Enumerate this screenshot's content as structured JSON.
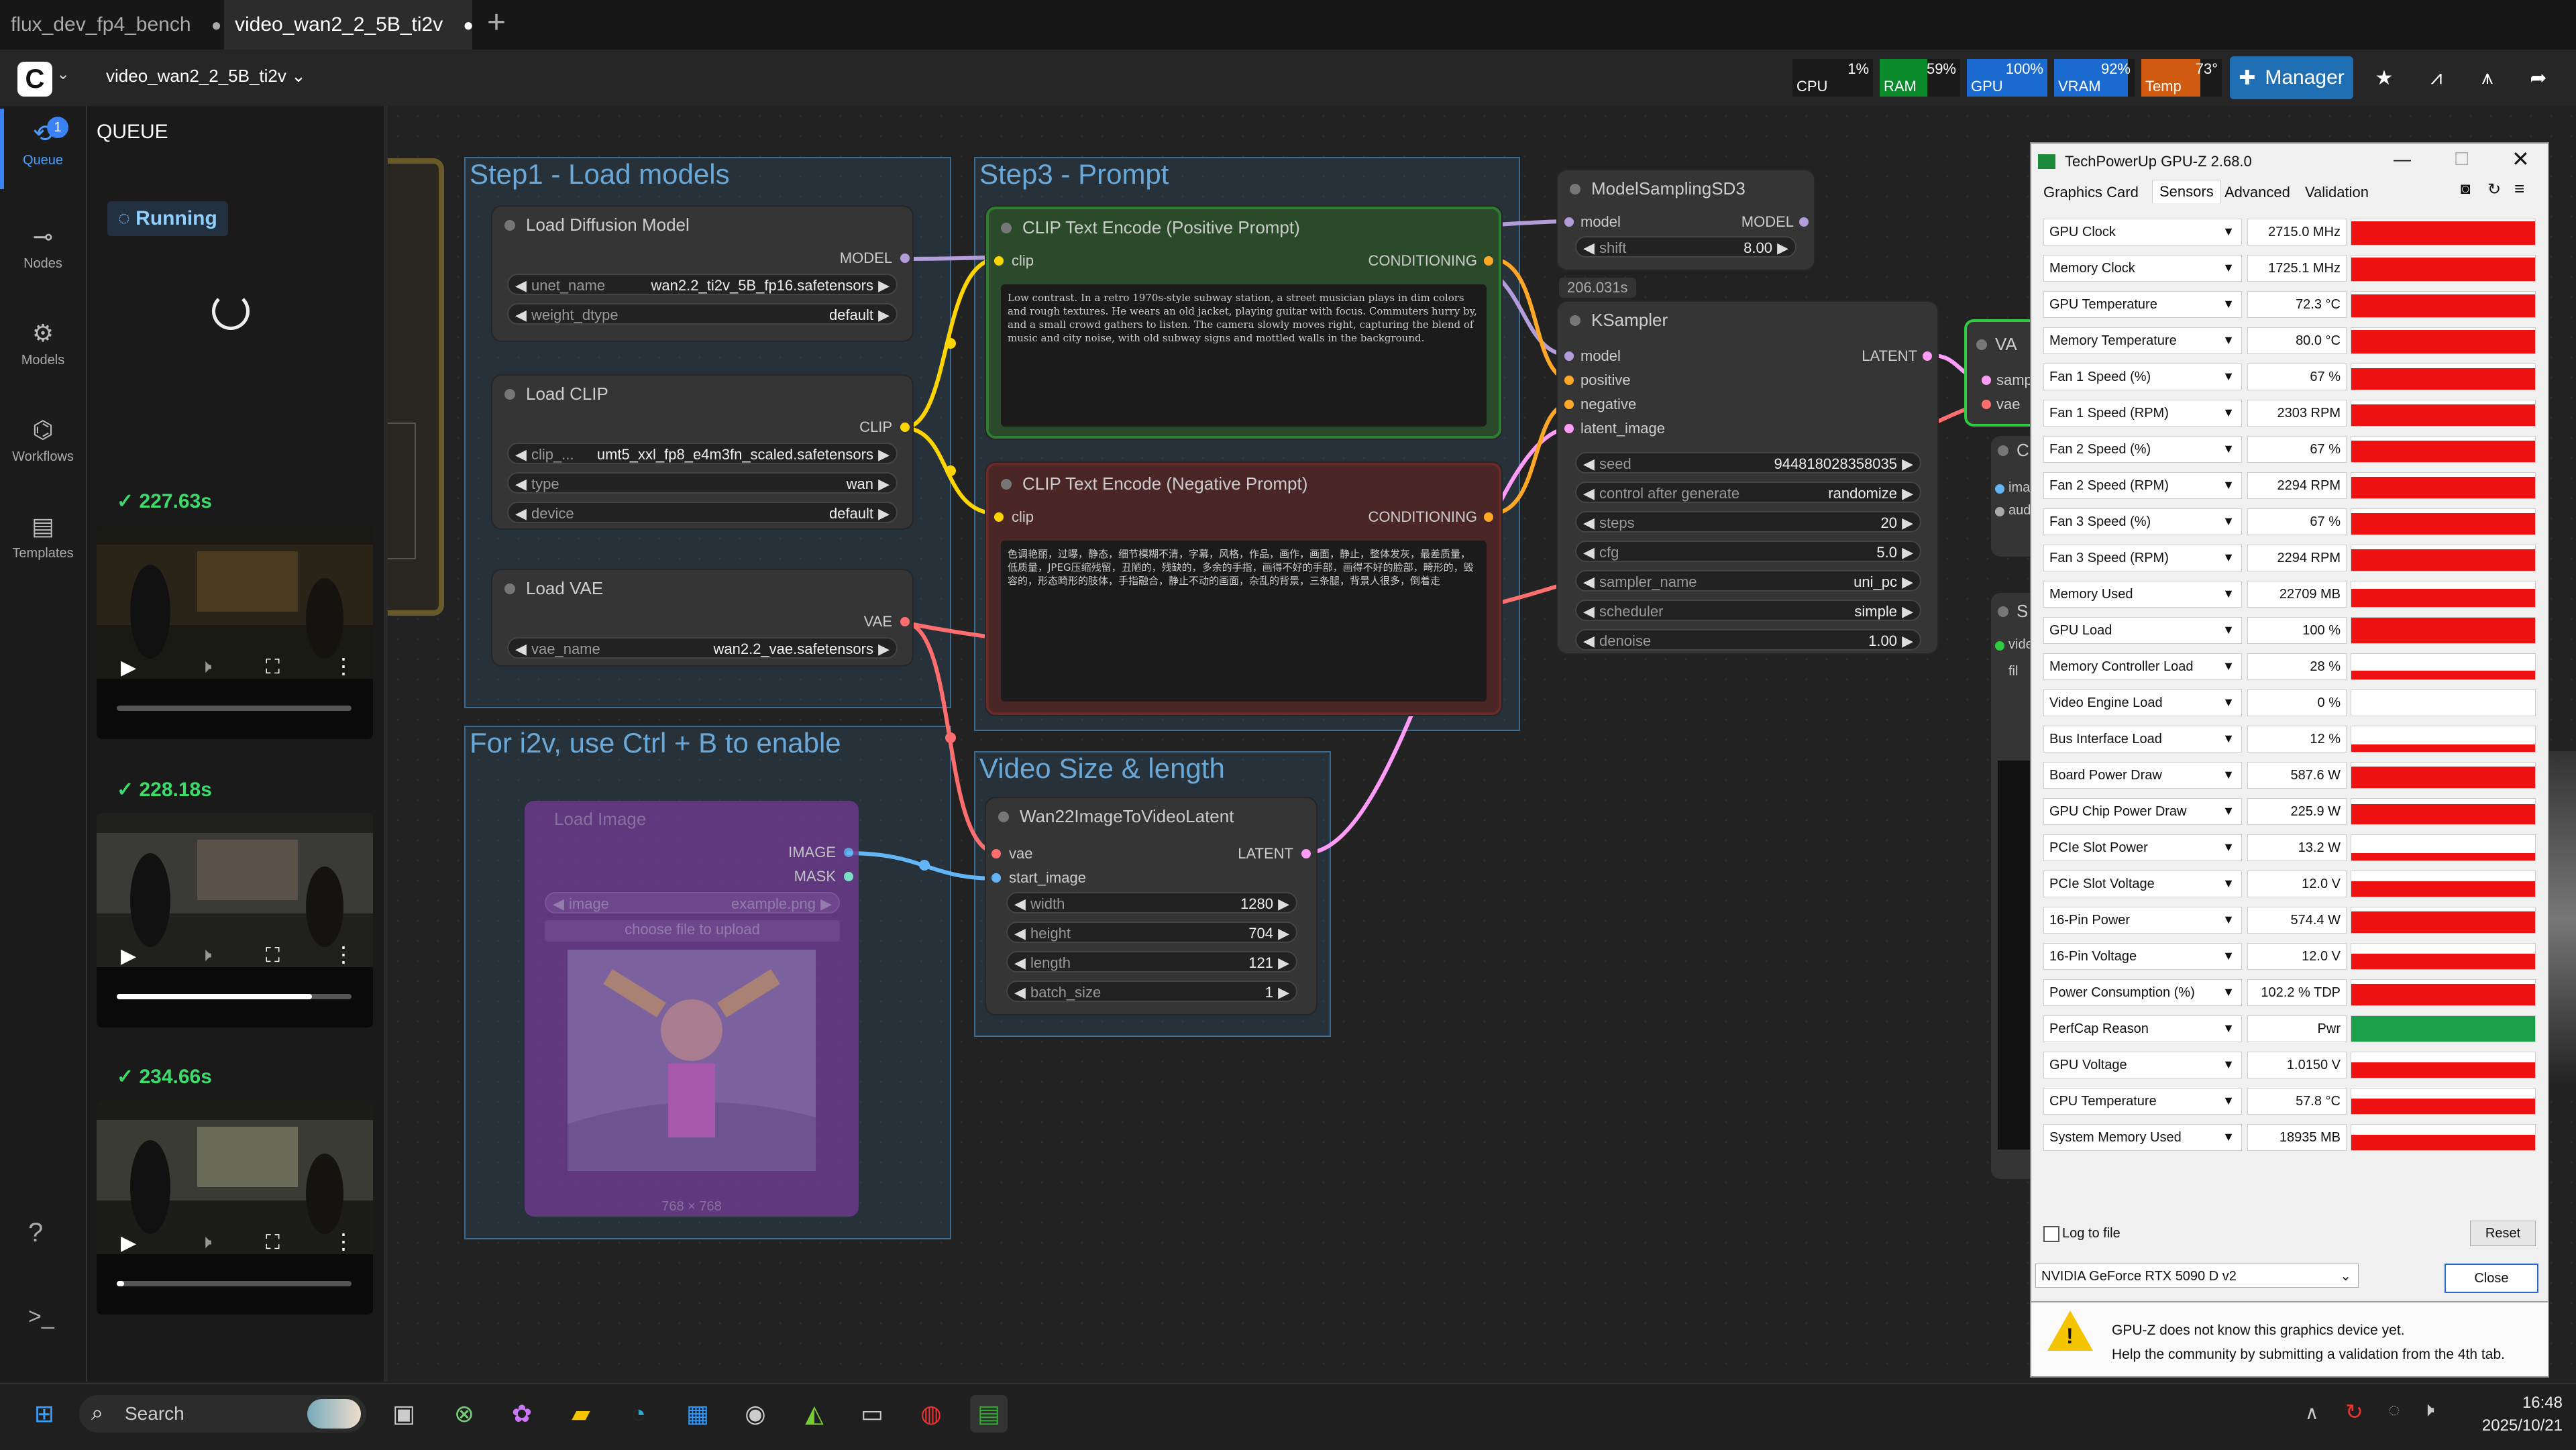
{
  "tabs": [
    {
      "label": "flux_dev_fp4_bench",
      "indicator": "●"
    },
    {
      "label": "video_wan2_2_5B_ti2v",
      "indicator": "●"
    }
  ],
  "new_tab": "+",
  "workflow_menu": {
    "label": "video_wan2_2_5B_ti2v",
    "chevron": "⌄",
    "logo": "C",
    "logo_chevron": "⌄"
  },
  "stats": [
    {
      "label": "CPU",
      "percent": "1%",
      "level": 0.01,
      "color": "#1a1a1a"
    },
    {
      "label": "RAM",
      "percent": "59%",
      "level": 0.59,
      "color": "#0a8a2a"
    },
    {
      "label": "GPU",
      "percent": "100%",
      "level": 1.0,
      "color": "#1a6ad0"
    },
    {
      "label": "VRAM",
      "percent": "92%",
      "level": 0.92,
      "color": "#1a6ad0"
    },
    {
      "label": "Temp",
      "percent": "73°",
      "level": 0.73,
      "color": "#d05a10"
    }
  ],
  "manager_button": "Manager",
  "sidebar": {
    "items": [
      {
        "label": "Queue",
        "icon": "history-icon",
        "badge": "1"
      },
      {
        "label": "Nodes",
        "icon": "nodes-icon"
      },
      {
        "label": "Models",
        "icon": "models-icon"
      },
      {
        "label": "Workflows",
        "icon": "workflows-icon"
      },
      {
        "label": "Templates",
        "icon": "templates-icon"
      }
    ]
  },
  "queue": {
    "title": "QUEUE",
    "running_label": "Running",
    "items": [
      {
        "time": "227.63s",
        "progress": 0.0
      },
      {
        "time": "228.18s",
        "progress": 0.83
      },
      {
        "time": "234.66s",
        "progress": 0.03
      }
    ]
  },
  "groups": {
    "step1": "Step1 - Load models",
    "step3": "Step3 - Prompt",
    "i2v": "For i2v, use Ctrl + B to enable",
    "video": "Video Size & length"
  },
  "nodes": {
    "load_diffusion": {
      "title": "Load Diffusion Model",
      "output": "MODEL",
      "widgets": [
        {
          "label": "unet_name",
          "value": "wan2.2_ti2v_5B_fp16.safetensors"
        },
        {
          "label": "weight_dtype",
          "value": "default"
        }
      ]
    },
    "load_clip": {
      "title": "Load CLIP",
      "output": "CLIP",
      "widgets": [
        {
          "label": "clip_...",
          "value": "umt5_xxl_fp8_e4m3fn_scaled.safetensors"
        },
        {
          "label": "type",
          "value": "wan"
        },
        {
          "label": "device",
          "value": "default"
        }
      ]
    },
    "load_vae": {
      "title": "Load VAE",
      "output": "VAE",
      "widgets": [
        {
          "label": "vae_name",
          "value": "wan2.2_vae.safetensors"
        }
      ]
    },
    "load_image": {
      "title": "Load Image",
      "outputs": [
        "IMAGE",
        "MASK"
      ],
      "widgets": [
        {
          "label": "image",
          "value": "example.png"
        }
      ],
      "upload_label": "choose file to upload",
      "size_label": "768 × 768"
    },
    "clip_pos": {
      "title": "CLIP Text Encode (Positive Prompt)",
      "input": "clip",
      "output": "CONDITIONING",
      "text": "Low contrast. In a retro 1970s-style subway station, a street musician plays in dim colors and rough textures. He wears an old jacket, playing guitar with focus. Commuters hurry by, and a small crowd gathers to listen. The camera slowly moves right, capturing the blend of music and city noise, with old subway signs and mottled walls in the background."
    },
    "clip_neg": {
      "title": "CLIP Text Encode (Negative Prompt)",
      "input": "clip",
      "output": "CONDITIONING",
      "text": "色调艳丽，过曝，静态，细节模糊不清，字幕，风格，作品，画作，画面，静止，整体发灰，最差质量，低质量，JPEG压缩残留，丑陋的，残缺的，多余的手指，画得不好的手部，画得不好的脸部，畸形的，毁容的，形态畸形的肢体，手指融合，静止不动的画面，杂乱的背景，三条腿，背景人很多，倒着走"
    },
    "wan_latent": {
      "title": "Wan22ImageToVideoLatent",
      "inputs": [
        "vae",
        "start_image"
      ],
      "output": "LATENT",
      "widgets": [
        {
          "label": "width",
          "value": "1280"
        },
        {
          "label": "height",
          "value": "704"
        },
        {
          "label": "length",
          "value": "121"
        },
        {
          "label": "batch_size",
          "value": "1"
        }
      ]
    },
    "model_sampling": {
      "title": "ModelSamplingSD3",
      "input": "model",
      "output": "MODEL",
      "widgets": [
        {
          "label": "shift",
          "value": "8.00"
        }
      ]
    },
    "ksampler": {
      "timer": "206.031s",
      "title": "KSampler",
      "inputs": [
        "model",
        "positive",
        "negative",
        "latent_image"
      ],
      "output": "LATENT",
      "widgets": [
        {
          "label": "seed",
          "value": "944818028358035"
        },
        {
          "label": "control after generate",
          "value": "randomize"
        },
        {
          "label": "steps",
          "value": "20"
        },
        {
          "label": "cfg",
          "value": "5.0"
        },
        {
          "label": "sampler_name",
          "value": "uni_pc"
        },
        {
          "label": "scheduler",
          "value": "simple"
        },
        {
          "label": "denoise",
          "value": "1.00"
        }
      ]
    },
    "vae_decode": {
      "title": "VA",
      "inputs": [
        "samp",
        "vae"
      ]
    },
    "partial_node_1": {
      "title": "C",
      "inputs": [
        "ima",
        "aud"
      ]
    },
    "partial_node_2": {
      "title": "S",
      "inputs": [
        "vide"
      ],
      "widget": "fil"
    }
  },
  "gpuz": {
    "title": "TechPowerUp GPU-Z 2.68.0",
    "tabs": [
      "Graphics Card",
      "Sensors",
      "Advanced",
      "Validation"
    ],
    "sensors": [
      {
        "name": "GPU Clock",
        "value": "2715.0 MHz",
        "level": 0.92
      },
      {
        "name": "Memory Clock",
        "value": "1725.1 MHz",
        "level": 0.92
      },
      {
        "name": "GPU Temperature",
        "value": "72.3 °C",
        "level": 0.9
      },
      {
        "name": "Memory Temperature",
        "value": "80.0 °C",
        "level": 0.92
      },
      {
        "name": "Fan 1 Speed (%)",
        "value": "67 %",
        "level": 0.85
      },
      {
        "name": "Fan 1 Speed (RPM)",
        "value": "2303 RPM",
        "level": 0.85
      },
      {
        "name": "Fan 2 Speed (%)",
        "value": "67 %",
        "level": 0.85
      },
      {
        "name": "Fan 2 Speed (RPM)",
        "value": "2294 RPM",
        "level": 0.85
      },
      {
        "name": "Fan 3 Speed (%)",
        "value": "67 %",
        "level": 0.85
      },
      {
        "name": "Fan 3 Speed (RPM)",
        "value": "2294 RPM",
        "level": 0.85
      },
      {
        "name": "Memory Used",
        "value": "22709 MB",
        "level": 0.7
      },
      {
        "name": "GPU Load",
        "value": "100 %",
        "level": 1.0
      },
      {
        "name": "Memory Controller Load",
        "value": "28 %",
        "level": 0.35
      },
      {
        "name": "Video Engine Load",
        "value": "0 %",
        "level": 0.0
      },
      {
        "name": "Bus Interface Load",
        "value": "12 %",
        "level": 0.3
      },
      {
        "name": "Board Power Draw",
        "value": "587.6 W",
        "level": 0.85
      },
      {
        "name": "GPU Chip Power Draw",
        "value": "225.9 W",
        "level": 0.8
      },
      {
        "name": "PCIe Slot Power",
        "value": "13.2 W",
        "level": 0.3
      },
      {
        "name": "PCIe Slot Voltage",
        "value": "12.0 V",
        "level": 0.6
      },
      {
        "name": "16-Pin Power",
        "value": "574.4 W",
        "level": 0.85
      },
      {
        "name": "16-Pin Voltage",
        "value": "12.0 V",
        "level": 0.6
      },
      {
        "name": "Power Consumption (%)",
        "value": "102.2 % TDP",
        "level": 0.85
      },
      {
        "name": "PerfCap Reason",
        "value": "Pwr",
        "level": 1.0,
        "color": "#1aa04a"
      },
      {
        "name": "GPU Voltage",
        "value": "1.0150 V",
        "level": 0.6
      },
      {
        "name": "CPU Temperature",
        "value": "57.8 °C",
        "level": 0.6
      },
      {
        "name": "System Memory Used",
        "value": "18935 MB",
        "level": 0.6
      }
    ],
    "log_to_file": "Log to file",
    "reset_button": "Reset",
    "device": "NVIDIA GeForce RTX 5090 D v2",
    "close_button": "Close",
    "notice_line1": "GPU-Z does not know this graphics device yet.",
    "notice_line2": "Help the community by submitting a validation from the 4th tab."
  },
  "taskbar": {
    "search_placeholder": "Search",
    "time": "16:48",
    "date": "2025/10/21"
  },
  "colors": {
    "clip_wire": "#ffd500",
    "model_wire": "#b39ddb",
    "vae_wire": "#ff6e6e",
    "latent_wire": "#ff9cf9",
    "image_wire": "#64b5f6",
    "accent_green": "#3ddc6a"
  }
}
